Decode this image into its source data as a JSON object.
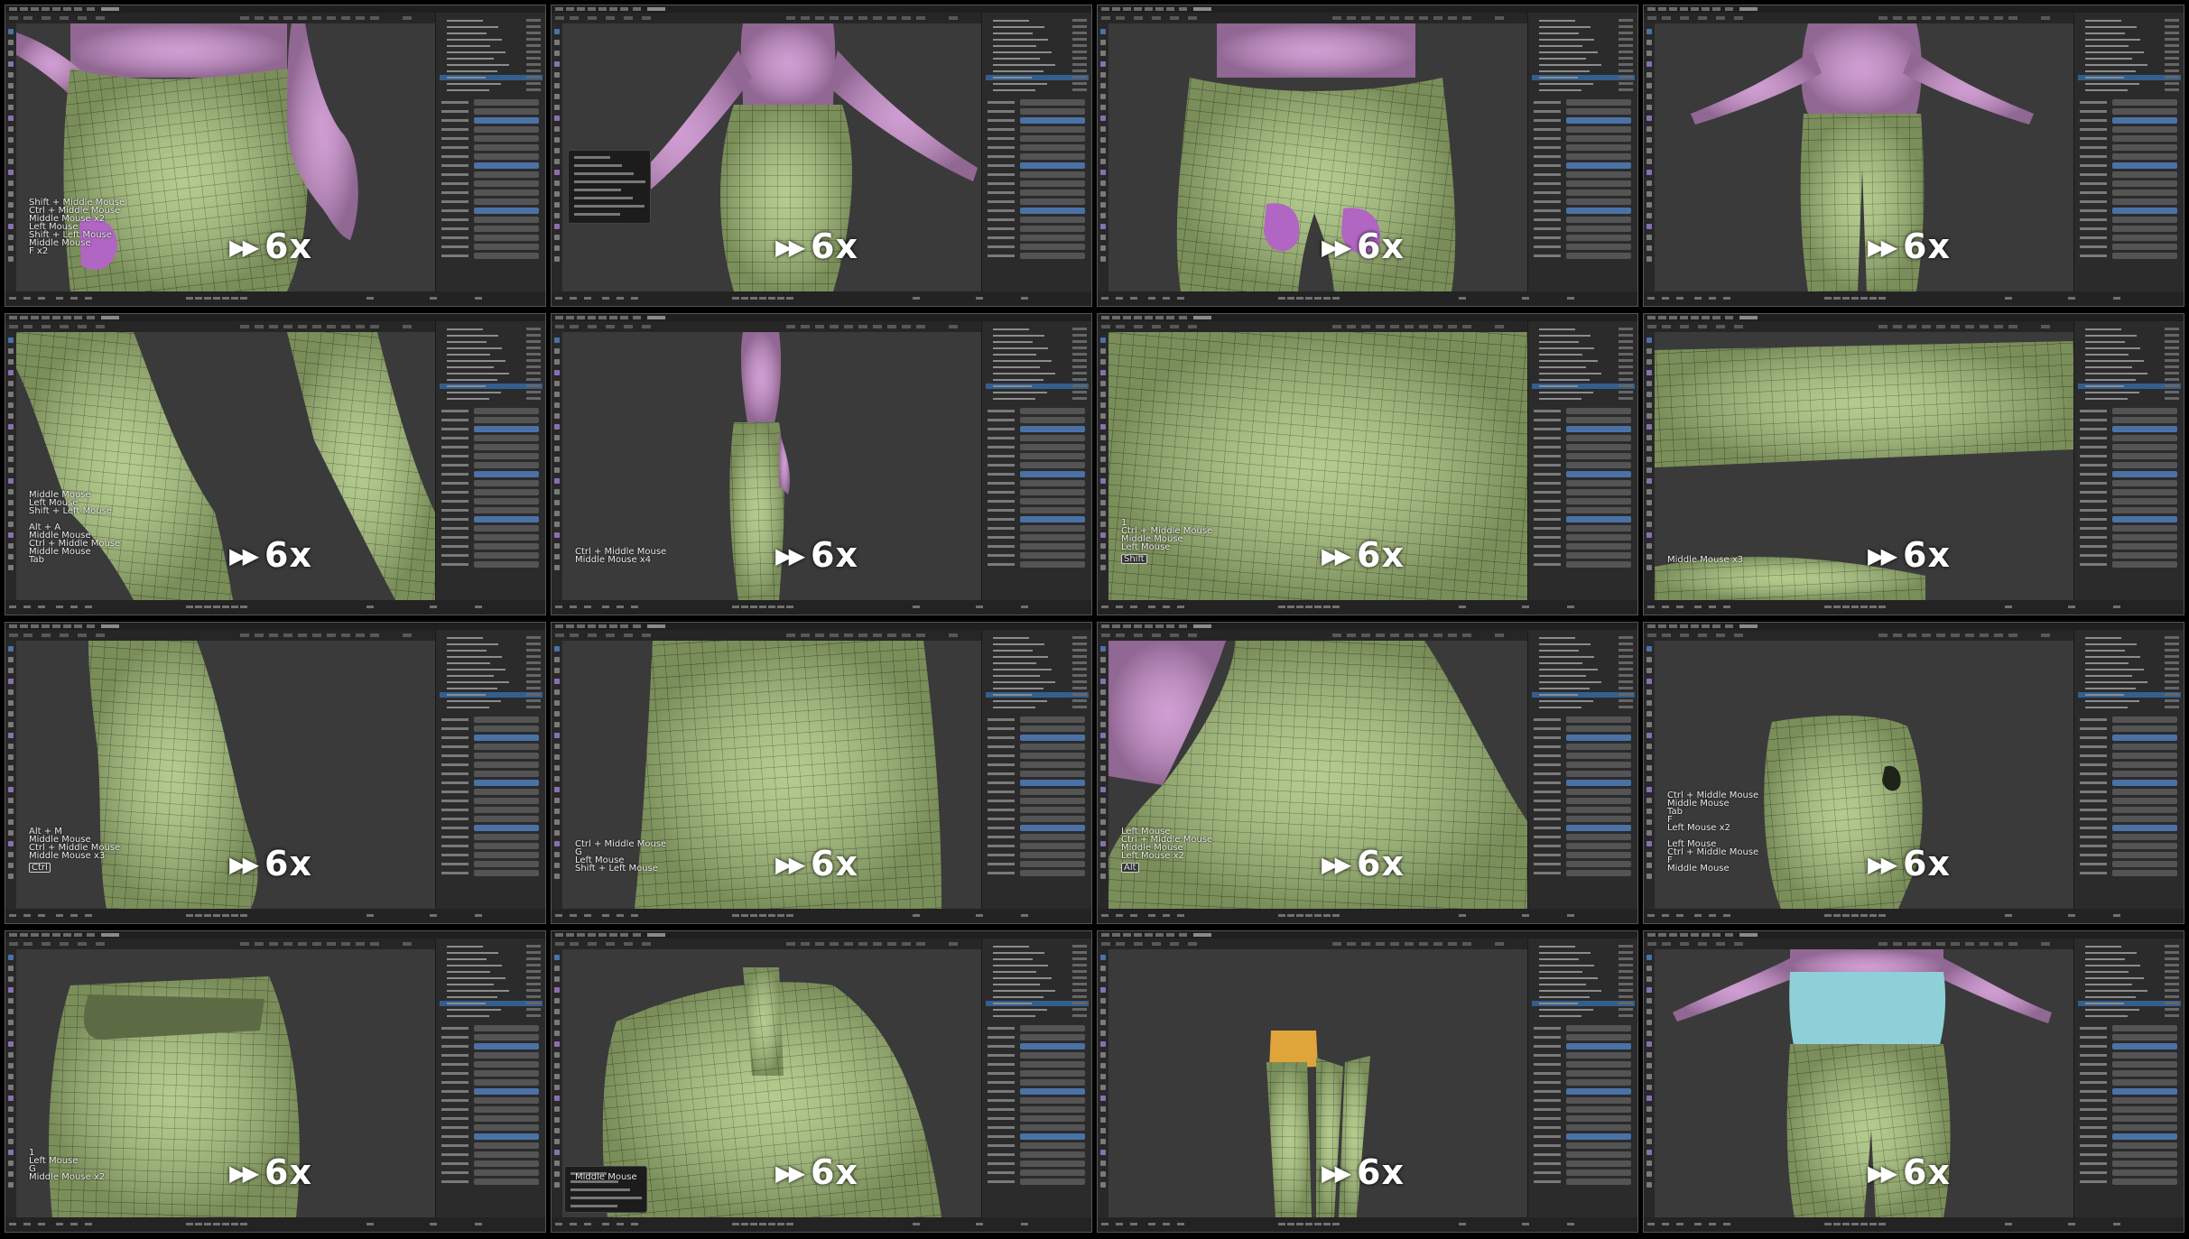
{
  "colors": {
    "skin": "#c98fcc",
    "mesh": "#a9c47d",
    "paint": "#b066c2",
    "top": "#8fd0d8",
    "waistband": "#e0a53a",
    "background": "#3a3a3a"
  },
  "icons": {
    "speed": "fast-forward-icon"
  },
  "tiles": [
    {
      "scene": "hip-hand",
      "speed": "6x",
      "keys": [
        "Shift + Middle Mouse",
        "Ctrl + Middle Mouse",
        "Middle Mouse x2",
        "Left Mouse",
        "Shift + Left Mouse",
        "Middle Mouse",
        "F x2"
      ]
    },
    {
      "scene": "back-arms",
      "speed": "6x",
      "keys": []
    },
    {
      "scene": "front-waist",
      "speed": "6x",
      "keys": []
    },
    {
      "scene": "full-figure",
      "speed": "6x",
      "keys": []
    },
    {
      "scene": "knee-bend",
      "speed": "6x",
      "keys": [
        "Middle Mouse",
        "Left Mouse",
        "Shift + Left Mouse",
        "",
        "Alt + A",
        "Middle Mouse",
        "Ctrl + Middle Mouse",
        "Middle Mouse",
        "Tab"
      ]
    },
    {
      "scene": "side-standing",
      "speed": "6x",
      "keys": [
        "Ctrl + Middle Mouse",
        "Middle Mouse x4"
      ]
    },
    {
      "scene": "crotch-close",
      "speed": "6x",
      "keys": [
        "1",
        "Ctrl + Middle Mouse",
        "Middle Mouse",
        "Left Mouse"
      ],
      "badge": "Shift"
    },
    {
      "scene": "legs-horizontal",
      "speed": "6x",
      "keys": [
        "Middle Mouse x3"
      ]
    },
    {
      "scene": "knee-side",
      "speed": "6x",
      "keys": [
        "Alt + M",
        "Middle Mouse",
        "Ctrl + Middle Mouse",
        "Middle Mouse x3"
      ],
      "badge": "Ctrl"
    },
    {
      "scene": "knee-folds",
      "speed": "6x",
      "keys": [
        "Ctrl + Middle Mouse",
        "G",
        "Left Mouse",
        "Shift + Left Mouse"
      ]
    },
    {
      "scene": "hip-crease",
      "speed": "6x",
      "keys": [
        "Left Mouse",
        "Ctrl + Middle Mouse",
        "Middle Mouse",
        "Left Mouse x2"
      ],
      "badge": "Alt"
    },
    {
      "scene": "back-dark",
      "speed": "6x",
      "keys": [
        "Ctrl + Middle Mouse",
        "Middle Mouse",
        "Tab",
        "F",
        "Left Mouse x2",
        "",
        "Left Mouse",
        "Ctrl + Middle Mouse",
        "F",
        "Middle Mouse"
      ]
    },
    {
      "scene": "back-open",
      "speed": "6x",
      "keys": [
        "1",
        "Left Mouse",
        "G",
        "Middle Mouse x2"
      ]
    },
    {
      "scene": "fly-close",
      "speed": "6x",
      "keys": [
        "Middle Mouse"
      ]
    },
    {
      "scene": "legs-yellow",
      "speed": "6x",
      "keys": []
    },
    {
      "scene": "full-top",
      "speed": "6x",
      "keys": []
    }
  ]
}
